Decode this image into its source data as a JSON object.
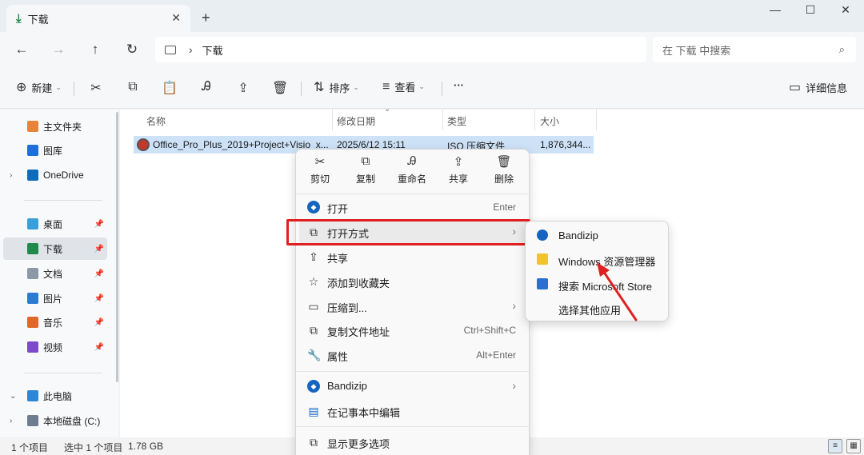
{
  "titlebar": {
    "tab_label": "下载",
    "close_glyph": "✕",
    "newtab_glyph": "+",
    "minimize_glyph": "—",
    "maximize_glyph": "☐",
    "window_close_glyph": "✕"
  },
  "address": {
    "crumb": "下载",
    "search_placeholder": "在 下载 中搜索"
  },
  "commands": {
    "new_label": "新建",
    "sort_label": "排序",
    "view_label": "查看",
    "more": "···",
    "details_label": "详细信息"
  },
  "sidebar": {
    "items": [
      {
        "label": "主文件夹",
        "color": "#e8833a"
      },
      {
        "label": "图库",
        "color": "#1e6fd9"
      },
      {
        "label": "OneDrive",
        "color": "#0f6cbd"
      },
      {
        "label": "桌面",
        "color": "#3aa0dc"
      },
      {
        "label": "下载",
        "color": "#1f8a4c"
      },
      {
        "label": "文档",
        "color": "#8a98a8"
      },
      {
        "label": "图片",
        "color": "#2b7bd3"
      },
      {
        "label": "音乐",
        "color": "#e3672d"
      },
      {
        "label": "视频",
        "color": "#7b4bc9"
      },
      {
        "label": "此电脑",
        "color": "#2f86d6"
      },
      {
        "label": "本地磁盘 (C:)",
        "color": "#6b7d8f"
      }
    ]
  },
  "columns": {
    "name": "名称",
    "date": "修改日期",
    "type": "类型",
    "size": "大小"
  },
  "file": {
    "name": "Office_Pro_Plus_2019+Project+Visio_x...",
    "date": "2025/6/12 15:11",
    "type": "ISO 压缩文件",
    "size": "1,876,344..."
  },
  "statusbar": {
    "count": "1 个项目",
    "selected": "选中 1 个项目",
    "size": "1.78 GB"
  },
  "context_menu": {
    "top_actions": [
      "剪切",
      "复制",
      "重命名",
      "共享",
      "删除"
    ],
    "items": [
      {
        "label": "打开",
        "shortcut": "Enter"
      },
      {
        "label": "打开方式",
        "shortcut": ""
      },
      {
        "label": "共享",
        "shortcut": ""
      },
      {
        "label": "添加到收藏夹",
        "shortcut": ""
      },
      {
        "label": "压缩到...",
        "shortcut": ""
      },
      {
        "label": "复制文件地址",
        "shortcut": "Ctrl+Shift+C"
      },
      {
        "label": "属性",
        "shortcut": "Alt+Enter"
      },
      {
        "label": "Bandizip",
        "shortcut": ""
      },
      {
        "label": "在记事本中编辑",
        "shortcut": ""
      },
      {
        "label": "显示更多选项",
        "shortcut": ""
      }
    ]
  },
  "open_with_submenu": {
    "items": [
      "Bandizip",
      "Windows 资源管理器",
      "搜索 Microsoft Store",
      "选择其他应用"
    ]
  },
  "accent_colors": {
    "highlight": "#e02020",
    "selection": "#cde1f7"
  }
}
